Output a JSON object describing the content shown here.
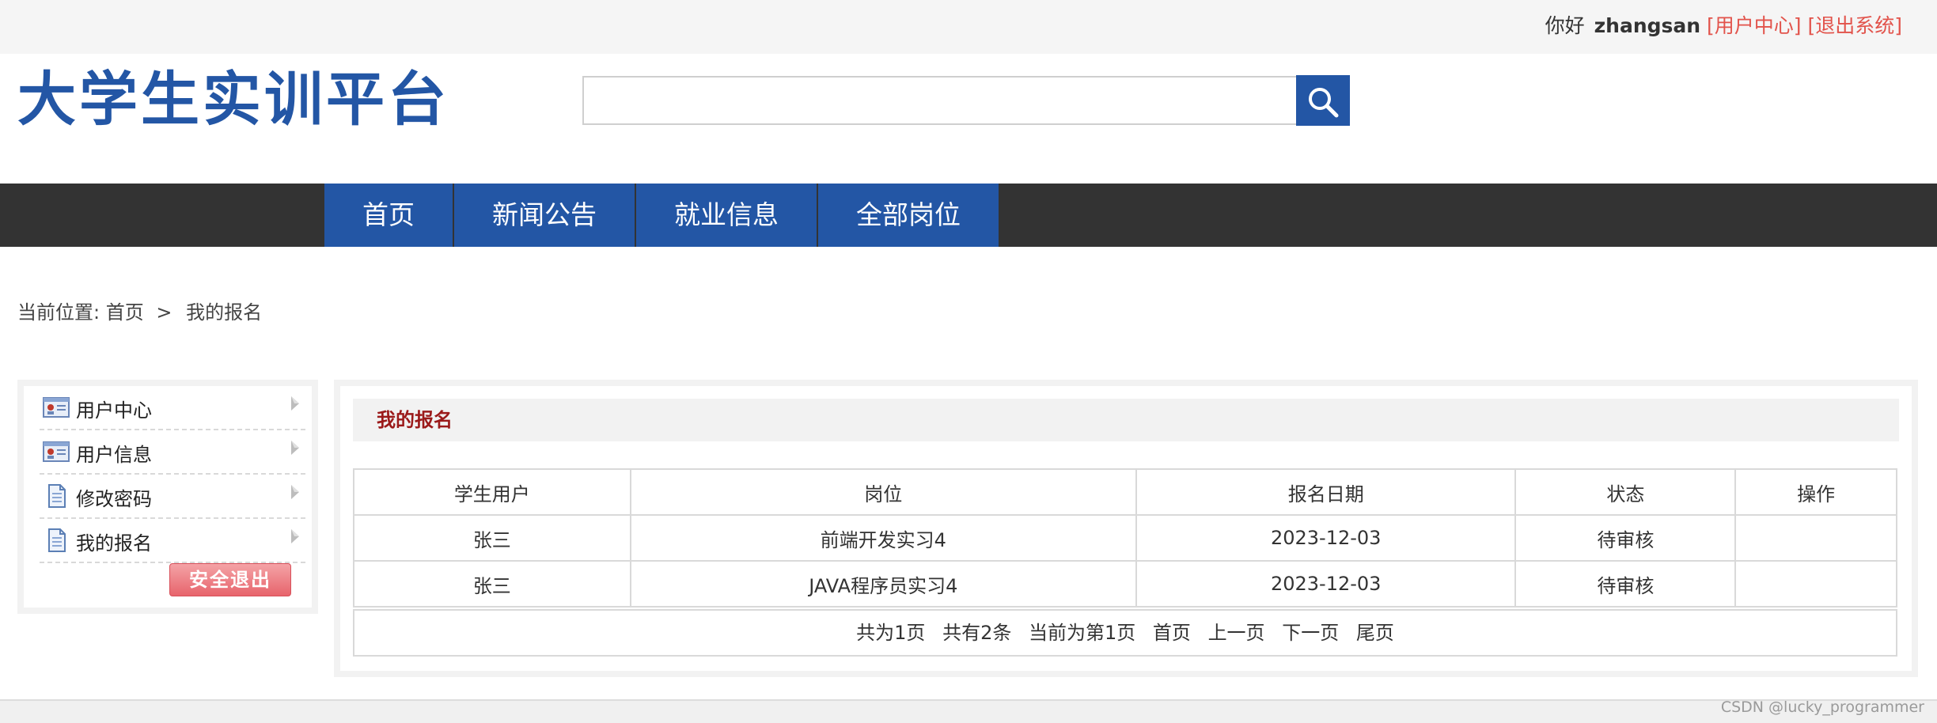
{
  "topbar": {
    "greeting": "你好",
    "username": "zhangsan",
    "user_center_link": "[用户中心]",
    "logout_link": "[退出系统]"
  },
  "header": {
    "site_title": "大学生实训平台",
    "search": {
      "value": "",
      "placeholder": ""
    },
    "search_icon": "search-icon"
  },
  "nav": {
    "items": [
      {
        "label": "首页"
      },
      {
        "label": "新闻公告"
      },
      {
        "label": "就业信息"
      },
      {
        "label": "全部岗位"
      }
    ]
  },
  "breadcrumb": {
    "prefix": "当前位置:",
    "home": "首页",
    "separator": ">",
    "current": "我的报名"
  },
  "sidebar": {
    "items": [
      {
        "label": "用户中心",
        "icon": "id-card-icon"
      },
      {
        "label": "用户信息",
        "icon": "id-card-icon"
      },
      {
        "label": "修改密码",
        "icon": "document-icon"
      },
      {
        "label": "我的报名",
        "icon": "document-icon"
      }
    ],
    "logout_button": "安全退出",
    "colors": {
      "logout_bg": "#e7646c"
    }
  },
  "main": {
    "title": "我的报名",
    "table": {
      "headers": [
        "学生用户",
        "岗位",
        "报名日期",
        "状态",
        "操作"
      ],
      "rows": [
        [
          "张三",
          "前端开发实习4",
          "2023-12-03",
          "待审核",
          ""
        ],
        [
          "张三",
          "JAVA程序员实习4",
          "2023-12-03",
          "待审核",
          ""
        ]
      ]
    },
    "pager": {
      "total_pages": "共为1页",
      "total_items": "共有2条",
      "current_page": "当前为第1页",
      "first": "首页",
      "prev": "上一页",
      "next": "下一页",
      "last": "尾页"
    }
  },
  "watermark": "CSDN @lucky_programmer",
  "colors": {
    "brand_blue": "#2356a5",
    "nav_dark": "#333333",
    "link_red": "#e2534b",
    "title_red": "#9b1a1a"
  }
}
